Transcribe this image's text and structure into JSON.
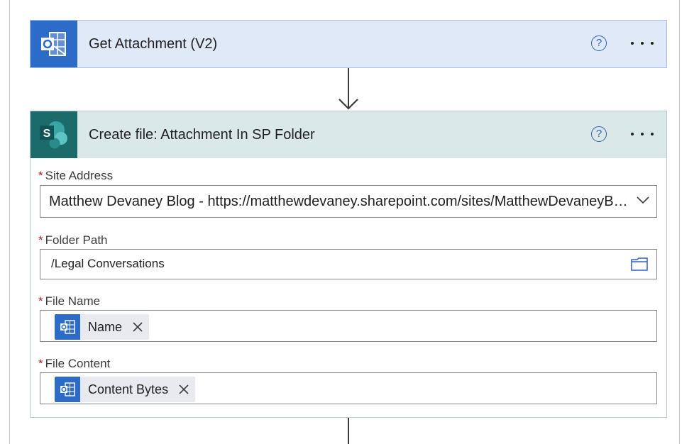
{
  "colors": {
    "outlook_blue": "#2d6bc9",
    "outlook_header_bg": "#dfe9f7",
    "sharepoint_teal": "#1b6b6b",
    "sharepoint_header_bg": "#dbe8e8",
    "required_red": "#a4262c",
    "help_blue": "#2e5fbf"
  },
  "steps": [
    {
      "title": "Get Attachment (V2)",
      "icon": "outlook-icon"
    },
    {
      "title": "Create file: Attachment In SP Folder",
      "icon": "sharepoint-icon",
      "fields": {
        "site_address": {
          "label": "Site Address",
          "required_mark": "*",
          "value": "Matthew Devaney Blog - https://matthewdevaney.sharepoint.com/sites/MatthewDevaneyBlog"
        },
        "folder_path": {
          "label": "Folder Path",
          "required_mark": "*",
          "value": "/Legal Conversations"
        },
        "file_name": {
          "label": "File Name",
          "required_mark": "*",
          "token": "Name"
        },
        "file_content": {
          "label": "File Content",
          "required_mark": "*",
          "token": "Content Bytes"
        }
      }
    }
  ],
  "help_glyph": "?"
}
